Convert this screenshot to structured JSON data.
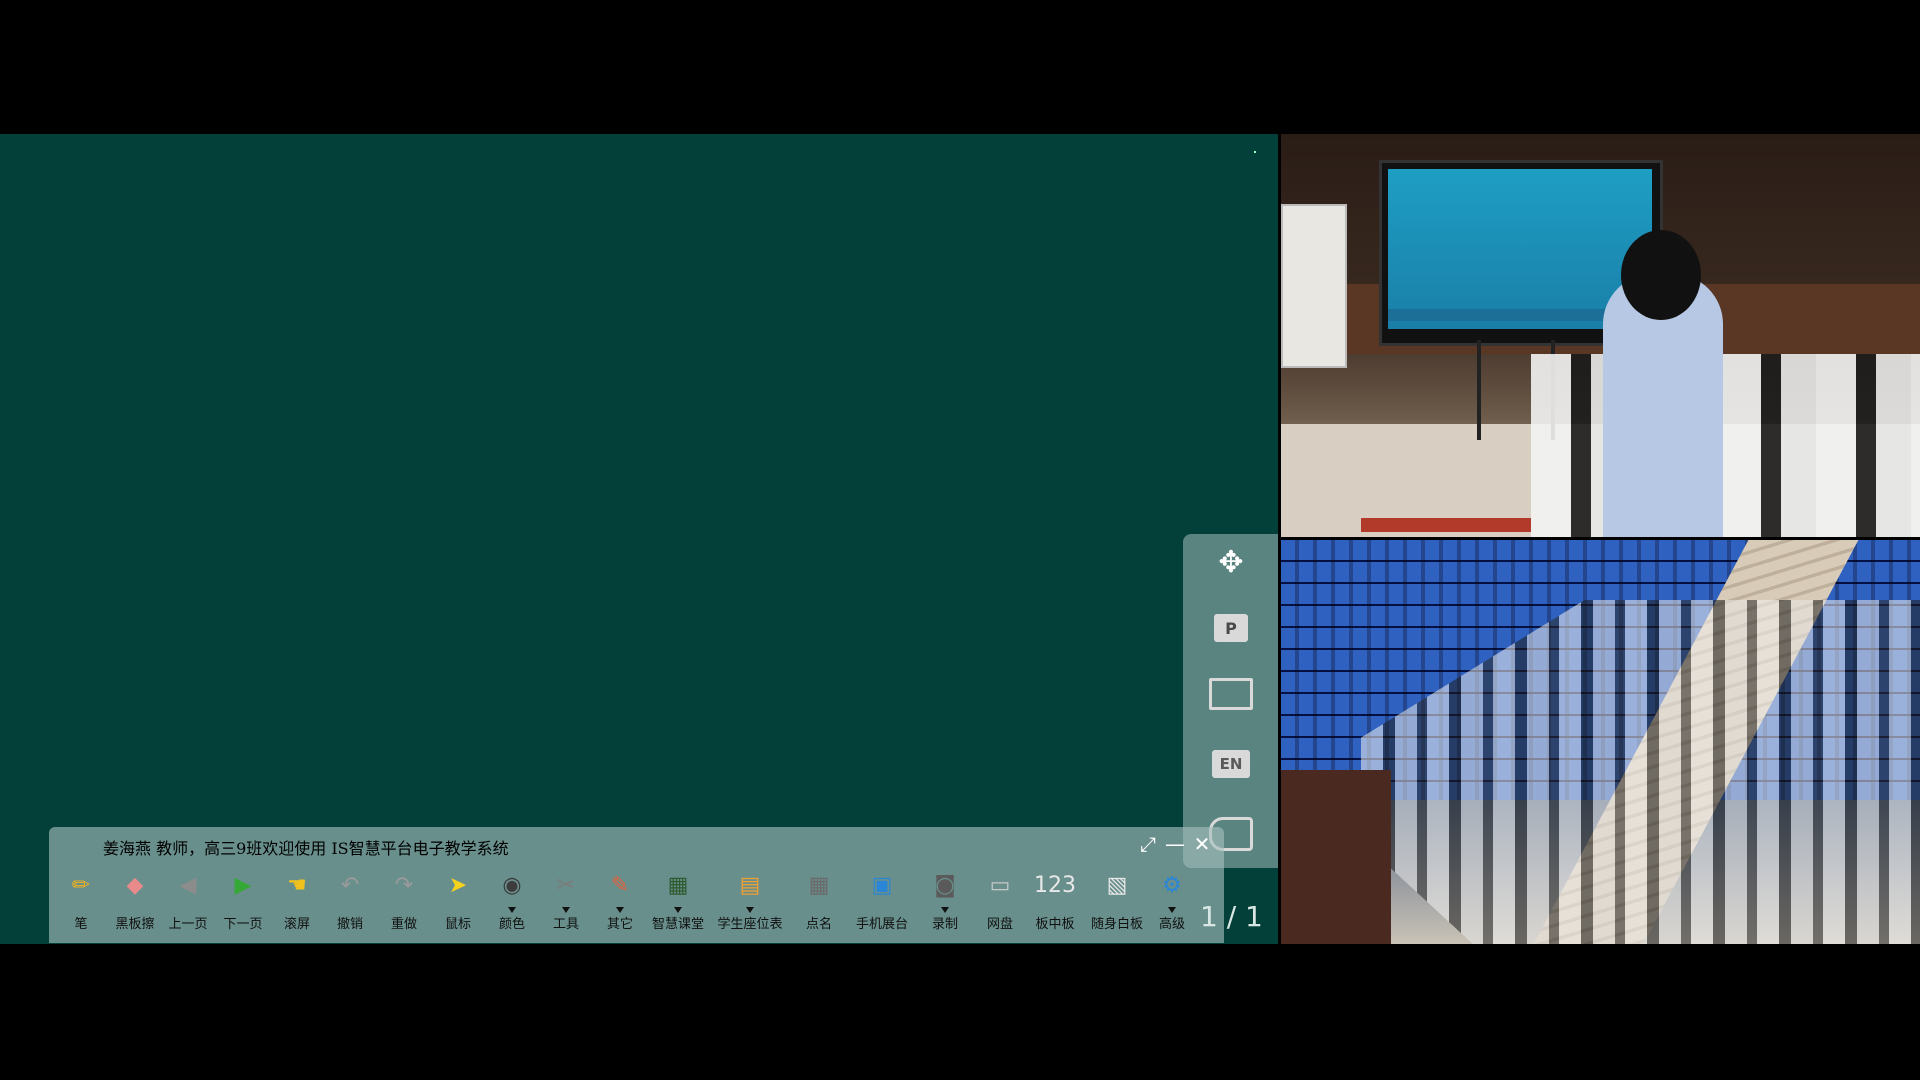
{
  "toolbar": {
    "title": "姜海燕  教师，高三9班欢迎使用 IS智慧平台电子教学系统",
    "expand_glyph": "⤢",
    "min_glyph": "—",
    "close_glyph": "✕",
    "tools": [
      {
        "label": "笔",
        "icon": "pencil-icon",
        "color": "#f2b21c",
        "glyph": "✏"
      },
      {
        "label": "黑板擦",
        "icon": "eraser-icon",
        "color": "#e88a8a",
        "glyph": "◆"
      },
      {
        "label": "上一页",
        "icon": "prev-page-icon",
        "color": "#8c8c8c",
        "glyph": "◀"
      },
      {
        "label": "下一页",
        "icon": "next-page-icon",
        "color": "#36a836",
        "glyph": "▶"
      },
      {
        "label": "滚屏",
        "icon": "hand-icon",
        "color": "#f2c21c",
        "glyph": "☚"
      },
      {
        "label": "撤销",
        "icon": "undo-icon",
        "color": "#9a9a9a",
        "glyph": "↶"
      },
      {
        "label": "重做",
        "icon": "redo-icon",
        "color": "#9a9a9a",
        "glyph": "↷"
      },
      {
        "label": "鼠标",
        "icon": "cursor-icon",
        "color": "#f5d21c",
        "glyph": "➤"
      },
      {
        "label": "颜色",
        "icon": "color-palette-icon",
        "color": "#3c3c3c",
        "glyph": "◉",
        "has_arrow": true
      },
      {
        "label": "工具",
        "icon": "tools-icon",
        "color": "#7a7a7a",
        "glyph": "✂",
        "has_arrow": true
      },
      {
        "label": "其它",
        "icon": "other-icon",
        "color": "#e0643c",
        "glyph": "✎",
        "has_arrow": true
      },
      {
        "label": "智慧课堂",
        "icon": "smart-class-icon",
        "color": "#2f5a2f",
        "glyph": "▦",
        "has_arrow": true
      },
      {
        "label": "学生座位表",
        "icon": "seat-chart-icon",
        "color": "#f0a030",
        "glyph": "▤",
        "has_arrow": true
      },
      {
        "label": "点名",
        "icon": "roll-call-icon",
        "color": "#6a6a6a",
        "glyph": "▦"
      },
      {
        "label": "手机展台",
        "icon": "phone-booth-icon",
        "color": "#2a86d6",
        "glyph": "▣"
      },
      {
        "label": "录制",
        "icon": "record-icon",
        "color": "#5a5a5a",
        "glyph": "◙",
        "has_arrow": true
      },
      {
        "label": "网盘",
        "icon": "cloud-drive-icon",
        "color": "#c8c8c8",
        "glyph": "▭"
      },
      {
        "label": "板中板",
        "icon": "board-in-board-icon",
        "color": "#e8e8e8",
        "glyph": "123"
      },
      {
        "label": "随身白板",
        "icon": "portable-whiteboard-icon",
        "color": "#e8e8e8",
        "glyph": "▧"
      },
      {
        "label": "高级",
        "icon": "advanced-settings-icon",
        "color": "#2a86d6",
        "glyph": "⚙",
        "has_arrow": true
      }
    ]
  },
  "side_panel": {
    "items": [
      {
        "icon": "move-icon",
        "glyph": "✥"
      },
      {
        "icon": "ppt-icon",
        "glyph": "P"
      },
      {
        "icon": "presentation-screen-icon",
        "glyph": ""
      },
      {
        "icon": "english-icon",
        "glyph": "EN"
      },
      {
        "icon": "camera-user-icon",
        "glyph": ""
      }
    ]
  },
  "page_indicator": "1 / 1",
  "colors": {
    "board": "#03403a",
    "toolbar": "#a6c0be"
  }
}
